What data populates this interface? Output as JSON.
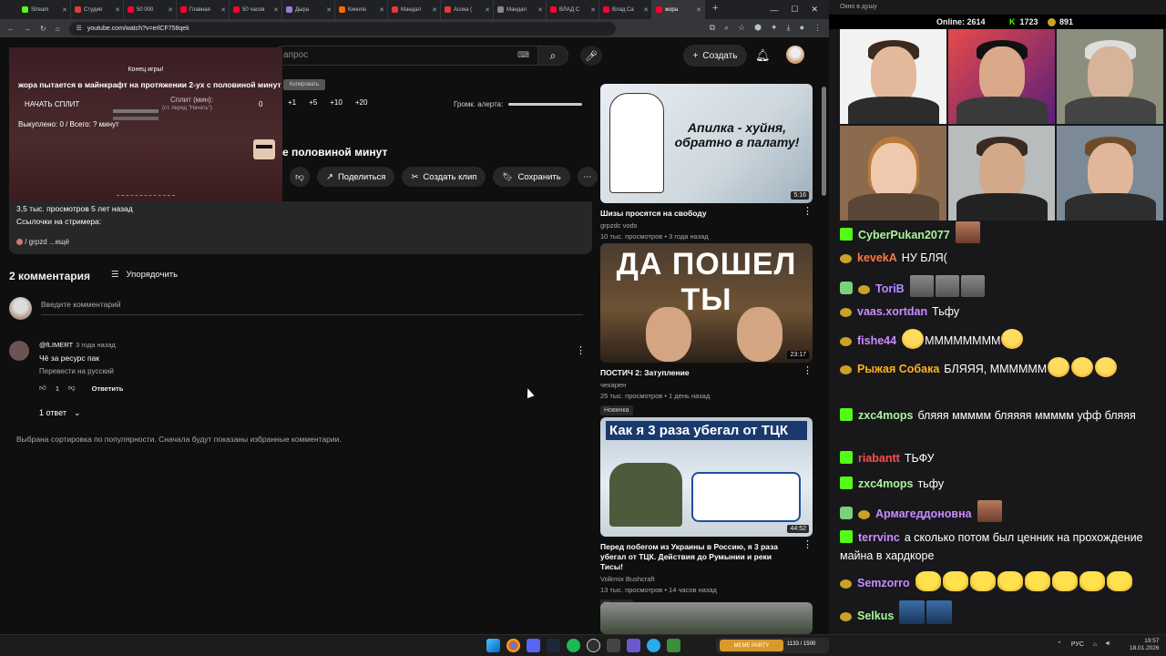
{
  "browser": {
    "tabs": [
      {
        "label": "Stream",
        "color": "#53fc18"
      },
      {
        "label": "Студия",
        "color": "#e03a3a"
      },
      {
        "label": "50 000",
        "color": "#ff0033"
      },
      {
        "label": "Главная",
        "color": "#ff0033"
      },
      {
        "label": "50 часов",
        "color": "#ff0033"
      },
      {
        "label": "Дыра",
        "color": "#9b7ad8"
      },
      {
        "label": "Кинопо",
        "color": "#ff6600"
      },
      {
        "label": "Мандал",
        "color": "#e03a3a"
      },
      {
        "label": "Асока (",
        "color": "#e03a3a"
      },
      {
        "label": "Мандал",
        "color": "#888888"
      },
      {
        "label": "ВЛАД С",
        "color": "#ff0033"
      },
      {
        "label": "Влад Са",
        "color": "#ff0033"
      },
      {
        "label": "жора",
        "color": "#ff0033"
      }
    ],
    "url": "youtube.com/watch?v=erlCF758qek"
  },
  "youtube": {
    "search_placeholder": "апрос",
    "create_label": "Создать",
    "overlay": {
      "game_over": "Конец игры!",
      "heading": "жора пытается в майнкрафт на протяжении 2-ух с половиной минут",
      "start_split": "НАЧАТЬ СПЛИТ",
      "split_min": "Сплит (мин):",
      "split_value": "0",
      "hint": "(ст. перед \"Начать\")",
      "bought": "Выкуплено: 0 / Всего: ? минут"
    },
    "lang_pill": "Копировать",
    "controls": [
      "+1",
      "+5",
      "+10",
      "+20"
    ],
    "alert_label": "Громк. алерта:",
    "video_title": "е половиной минут",
    "actions": {
      "share": "Поделиться",
      "clip": "Создать клип",
      "save": "Сохранить"
    },
    "description": {
      "stats": "3,5 тыс. просмотров  5 лет назад",
      "line2": "Ссылочки на стримера:",
      "link": "/ grpzd",
      "more": "...ещё"
    },
    "comments": {
      "count": "2 комментария",
      "sort": "Упорядочить",
      "input_placeholder": "Введите комментарий",
      "items": [
        {
          "user": "@fLIMERT",
          "time": "3 года назад",
          "text": "Чё за ресурс пак",
          "translate": "Перевести на русский",
          "likes": "1",
          "reply": "Ответить"
        }
      ],
      "replies": "1 ответ",
      "sort_note": "Выбрана сортировка по популярности. Сначала будут показаны избранные комментарии."
    },
    "recommended": [
      {
        "title": "Шизы просятся на свободу",
        "channel": "grpzdc vods",
        "meta": "10 тыс. просмотров • 3 года назад",
        "duration": "5:16",
        "thumb_text": "Апилка - хуйня, обратно в палату!"
      },
      {
        "title": "ПОСТИЧ 2: Затупление",
        "channel": "чекарен",
        "meta": "25 тыс. просмотров • 1 день назад",
        "badge": "Новинка",
        "duration": "23:17",
        "thumb_text": "ДА ПОШЕЛ ТЫ"
      },
      {
        "title": "Перед побегом из Украины в Россию, я 3 раза убегал от ТЦК. Действия до Румынии и реки Тисы!",
        "channel": "Volkmix Bushcraft",
        "meta": "13 тыс. просмотров • 14 часов назад",
        "badge": "Новинка",
        "duration": "44:52",
        "thumb_text": "Как я 3 раза убегал от ТЦК"
      }
    ]
  },
  "stream": {
    "window_title": "Окно в душу",
    "online_label": "Online:",
    "online": "2614",
    "viewers": "1723",
    "subs": "891",
    "chat": [
      {
        "user": "CyberPukan2077",
        "color": "#a8f59a",
        "badges": [
          "k"
        ],
        "text": ""
      },
      {
        "user": "kevekA",
        "color": "#ff7a3d",
        "badges": [
          "c"
        ],
        "text": "НУ БЛЯ("
      },
      {
        "user": "ToriB",
        "color": "#b58cff",
        "badges": [
          "s",
          "c"
        ],
        "text": ""
      },
      {
        "user": "vaas.xortdan",
        "color": "#c88cff",
        "badges": [
          "c"
        ],
        "text": "Тьфу"
      },
      {
        "user": "fishe44",
        "color": "#c88cff",
        "badges": [
          "c"
        ],
        "text": "ММММММММ"
      },
      {
        "user": "Рыжая Собака",
        "color": "#ffb020",
        "badges": [
          "c"
        ],
        "text": "БЛЯЯЯ, ММММММ"
      },
      {
        "user": "zxc4mops",
        "color": "#a8f59a",
        "badges": [
          "k"
        ],
        "text": "бляяя ммммм бляяяя ммммм уфф бляяя"
      },
      {
        "user": "riabantt",
        "color": "#ff4d4d",
        "badges": [
          "k"
        ],
        "text": "ТЬФУ"
      },
      {
        "user": "zxc4mops",
        "color": "#a8f59a",
        "badges": [
          "k"
        ],
        "text": "тьфу"
      },
      {
        "user": "Армагеддоновна",
        "color": "#c88cff",
        "badges": [
          "s",
          "c"
        ],
        "text": ""
      },
      {
        "user": "terrvinc",
        "color": "#c88cff",
        "badges": [
          "k"
        ],
        "text": "а сколько потом был ценник на прохождение майна в хардкоре"
      },
      {
        "user": "Semzorro",
        "color": "#c88cff",
        "badges": [
          "c"
        ],
        "text": ""
      },
      {
        "user": "Selkus",
        "color": "#a8f59a",
        "badges": [
          "c"
        ],
        "text": ""
      }
    ]
  },
  "taskbar": {
    "pill_label": "MEME PARTY",
    "pill_text": "1133 / 1500",
    "lang": "РУС",
    "time": "19:57",
    "date": "18.01.2026"
  }
}
